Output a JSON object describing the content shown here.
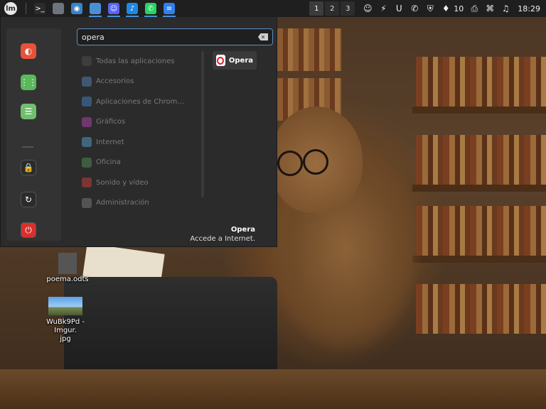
{
  "panel": {
    "launchers": [
      {
        "icon": "terminal-icon",
        "color": "#2b2b2b",
        "glyph": ">_"
      },
      {
        "icon": "folder-icon",
        "color": "#6c757d",
        "glyph": ""
      },
      {
        "icon": "screenshot-icon",
        "color": "#3b82c4",
        "glyph": "◉"
      },
      {
        "icon": "chromium-icon",
        "color": "#4a8fd6",
        "glyph": ""
      },
      {
        "icon": "discord-icon",
        "color": "#5865f2",
        "glyph": "☺"
      },
      {
        "icon": "tiktok-icon",
        "color": "#1e88e5",
        "glyph": "♪"
      },
      {
        "icon": "whatsapp-icon",
        "color": "#25d366",
        "glyph": "✆"
      },
      {
        "icon": "text-editor-icon",
        "color": "#2f80ed",
        "glyph": "≡"
      }
    ],
    "workspaces": [
      "1",
      "2",
      "3"
    ],
    "tray": [
      {
        "icon": "discord-tray-icon",
        "glyph": "☺"
      },
      {
        "icon": "pomodoro-tray-icon",
        "glyph": "⚡"
      },
      {
        "icon": "u-app-tray-icon",
        "glyph": "U"
      },
      {
        "icon": "whatsapp-tray-icon",
        "glyph": "✆"
      },
      {
        "icon": "shield-tray-icon",
        "glyph": "⛨"
      },
      {
        "icon": "notification-tray-icon",
        "glyph": "♦"
      }
    ],
    "notification_count": "10",
    "tray_right": [
      {
        "icon": "printer-icon",
        "glyph": "⎙"
      },
      {
        "icon": "network-icon",
        "glyph": "⌘"
      },
      {
        "icon": "music-icon",
        "glyph": "♫"
      }
    ],
    "clock": "18:29"
  },
  "menu": {
    "search": {
      "value": "opera",
      "placeholder": ""
    },
    "favorites": [
      {
        "icon": "firefox-icon",
        "color": "#e8513a",
        "glyph": "◐"
      },
      {
        "icon": "app-grid-icon",
        "color": "#5cb85c",
        "glyph": "⋮⋮"
      },
      {
        "icon": "settings-toggle-icon",
        "color": "#6fbf6f",
        "glyph": "☰"
      }
    ],
    "session": [
      {
        "icon": "lock-icon",
        "color": "#2b2b2b",
        "glyph": "🔒"
      },
      {
        "icon": "logout-icon",
        "color": "#2b2b2b",
        "glyph": "↻"
      },
      {
        "icon": "power-icon",
        "color": "#d9302c",
        "glyph": "⏻"
      }
    ],
    "categories": [
      {
        "label": "Todas las aplicaciones",
        "icon": "all-apps-icon",
        "color": "#555555"
      },
      {
        "label": "Accesorios",
        "icon": "accessories-icon",
        "color": "#5b8fc7"
      },
      {
        "label": "Aplicaciones de Chrom…",
        "icon": "chrome-apps-icon",
        "color": "#4a8fd6"
      },
      {
        "label": "Gráficos",
        "icon": "graphics-icon",
        "color": "#c04ac0"
      },
      {
        "label": "Internet",
        "icon": "internet-icon",
        "color": "#5bb0e0"
      },
      {
        "label": "Oficina",
        "icon": "office-icon",
        "color": "#5a9a5a"
      },
      {
        "label": "Sonido y vídeo",
        "icon": "sound-video-icon",
        "color": "#e04040"
      },
      {
        "label": "Administración",
        "icon": "administration-icon",
        "color": "#888888"
      }
    ],
    "result": {
      "label": "Opera"
    },
    "description": {
      "name": "Opera",
      "text": "Accede a Internet."
    }
  },
  "desktop": {
    "files": [
      {
        "label": "poema.odts"
      },
      {
        "label": "WuBk9Pd - Imgur.\njpg"
      }
    ]
  }
}
